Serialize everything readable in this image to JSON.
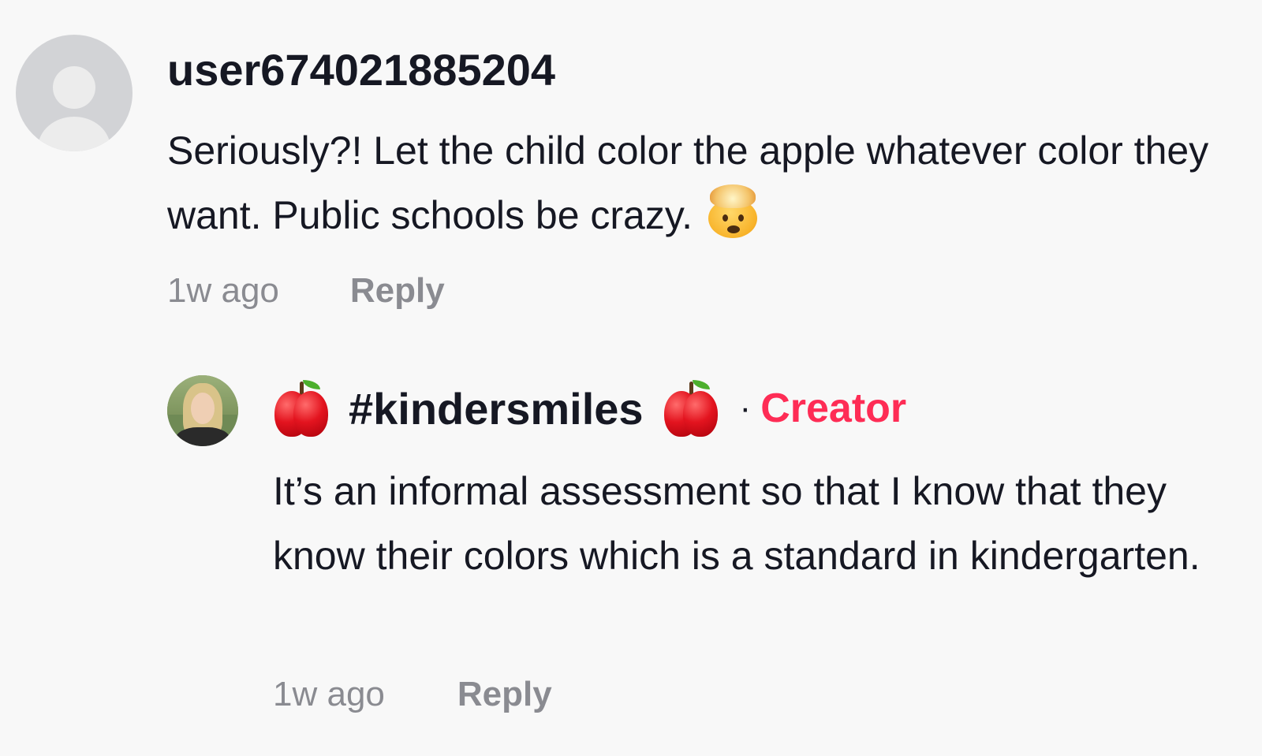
{
  "comment": {
    "username": "user674021885204",
    "text": "Seriously?! Let the child color the apple whatever color they want. Public schools be crazy.",
    "emoji": "exploding-head",
    "time": "1w ago",
    "reply_label": "Reply"
  },
  "reply": {
    "username": "#kindersmiles",
    "prefix_emoji": "red-apple",
    "suffix_emoji": "red-apple",
    "separator": "·",
    "badge": "Creator",
    "text": "It’s an informal assessment so that I know that they know their colors which is a standard in kindergarten.",
    "time": "1w ago",
    "reply_label": "Reply"
  },
  "colors": {
    "background": "#f8f8f8",
    "primary_text": "#161823",
    "secondary_text": "#8a8b91",
    "creator_badge": "#fe2c55",
    "default_avatar": "#d2d3d6"
  }
}
